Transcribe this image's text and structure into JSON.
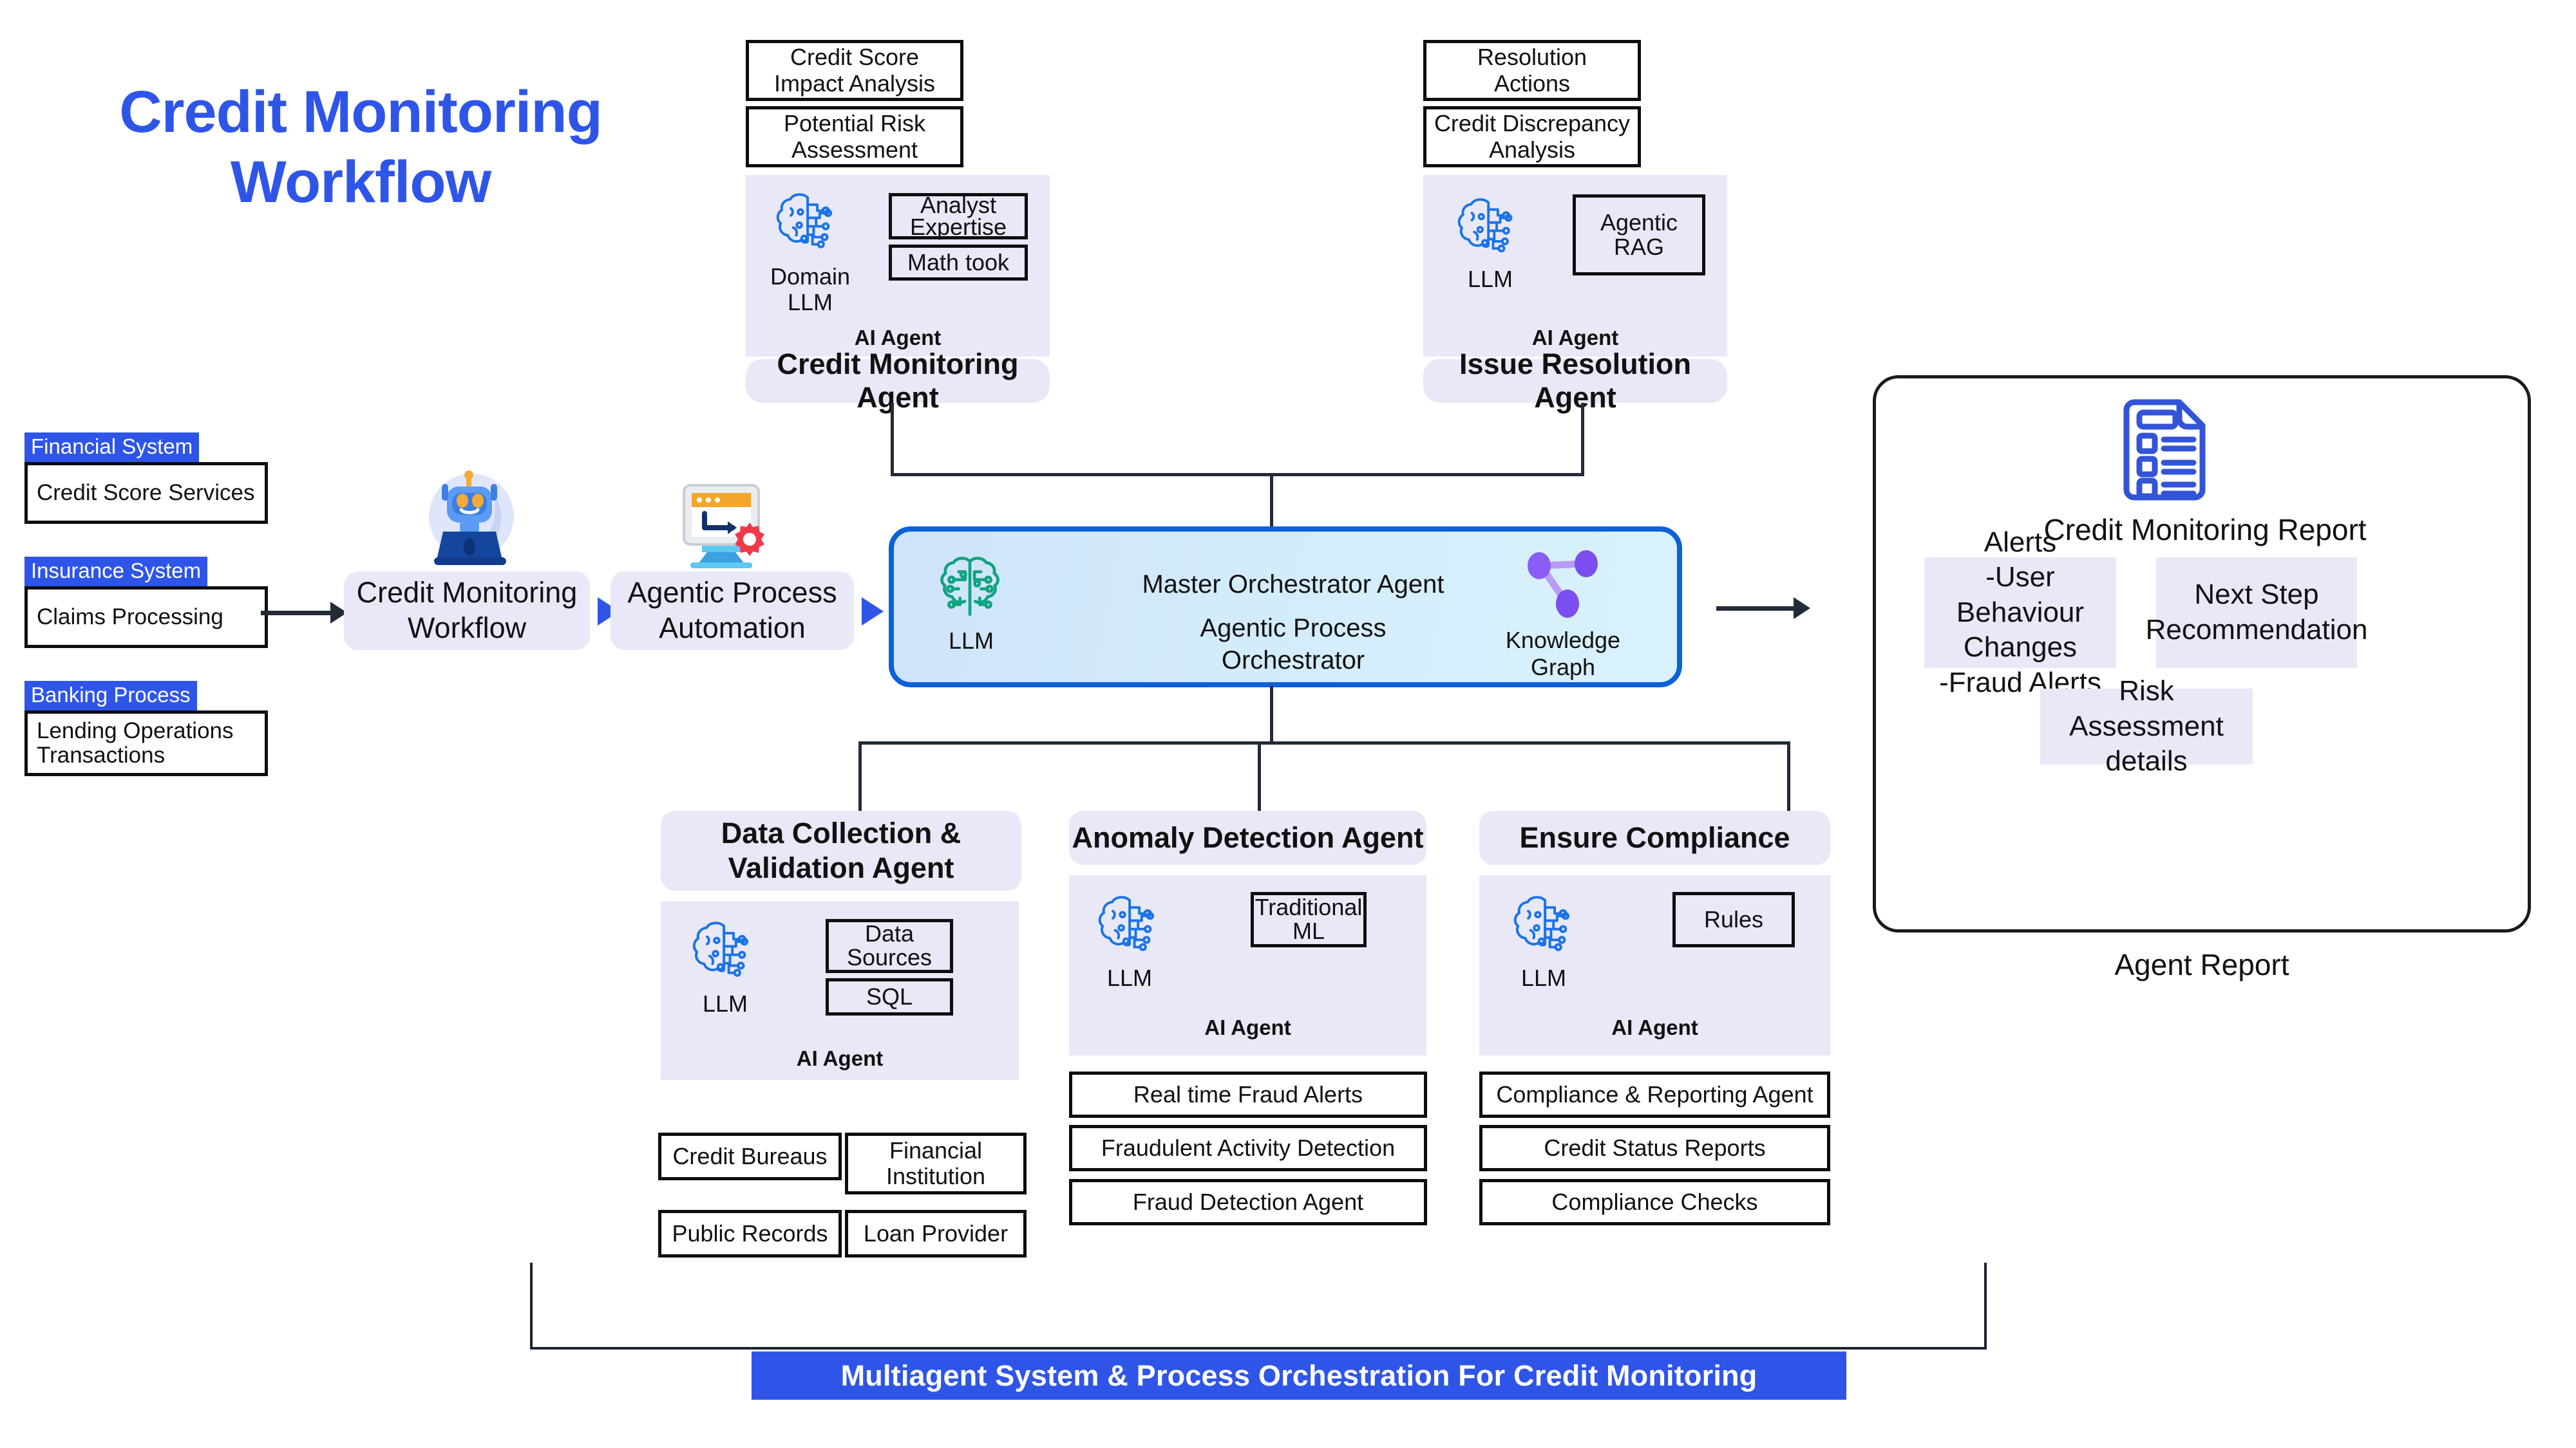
{
  "title": "Credit Monitoring\nWorkflow",
  "title_line1": "Credit Monitoring",
  "title_line2": "Workflow",
  "colors": {
    "brand_blue": "#2f55e8",
    "orchestrator_border": "#0b61d8",
    "lavender_panel": "#e8e8f7",
    "connector": "#222b38",
    "llm_icon_blue": "#1a73e8",
    "llm_icon_teal": "#10a37f",
    "knowledge_graph_purple": "#8b5cf6",
    "report_icon_blue": "#3354d6",
    "banner_blue": "#2f55e8"
  },
  "left_sources": [
    {
      "tag": "Financial System",
      "label": "Credit Score Services"
    },
    {
      "tag": "Insurance System",
      "label": "Claims Processing"
    },
    {
      "tag": "Banking Process",
      "label": "Lending Operations\nTransactions"
    }
  ],
  "pipeline": [
    {
      "icon": "robot-icon",
      "label": "Credit Monitoring\nWorkflow"
    },
    {
      "icon": "automation-gear-icon",
      "label": "Agentic Process\nAutomation"
    }
  ],
  "orchestrator": {
    "llm_label": "LLM",
    "line1": "Master Orchestrator Agent",
    "line2": "Agentic Process",
    "line3": "Orchestrator",
    "knowledge_graph_label": "Knowledge Graph"
  },
  "credit_monitoring_agent": {
    "top_boxes": [
      "Credit Score\nImpact Analysis",
      "Potential Risk\nAssessment"
    ],
    "llm_label": "Domain\nLLM",
    "tools": [
      "Analyst\nExpertise",
      "Math took"
    ],
    "ai_agent_label": "AI Agent",
    "name": "Credit Monitoring Agent"
  },
  "issue_resolution_agent": {
    "top_boxes": [
      "Resolution\nActions",
      "Credit Discrepancy\nAnalysis"
    ],
    "llm_label": "LLM",
    "tools": [
      "Agentic\nRAG"
    ],
    "ai_agent_label": "AI Agent",
    "name": "Issue Resolution Agent"
  },
  "data_collection_agent": {
    "name": "Data Collection &\nValidation Agent",
    "llm_label": "LLM",
    "tools": [
      "Data\nSources",
      "SQL"
    ],
    "ai_agent_label": "AI Agent",
    "outputs": [
      "Credit Bureaus",
      "Financial\nInstitution",
      "Public Records",
      "Loan Provider"
    ]
  },
  "anomaly_detection_agent": {
    "name": "Anomaly Detection Agent",
    "llm_label": "LLM",
    "tools": [
      "Traditional\nML"
    ],
    "ai_agent_label": "AI Agent",
    "outputs": [
      "Real time Fraud Alerts",
      "Fraudulent Activity Detection",
      "Fraud Detection Agent"
    ]
  },
  "compliance_agent": {
    "name": "Ensure Compliance",
    "llm_label": "LLM",
    "tools": [
      "Rules"
    ],
    "ai_agent_label": "AI Agent",
    "outputs": [
      "Compliance & Reporting Agent",
      "Credit Status Reports",
      "Compliance Checks"
    ]
  },
  "report": {
    "icon": "document-checklist-icon",
    "title": "Credit Monitoring Report",
    "boxes": [
      "Alerts\n-User Behaviour\nChanges\n-Fraud Alerts",
      "Next Step\nRecommendation",
      "Risk Assessment\ndetails"
    ],
    "caption": "Agent Report"
  },
  "banner": "Multiagent System & Process Orchestration For Credit Monitoring"
}
